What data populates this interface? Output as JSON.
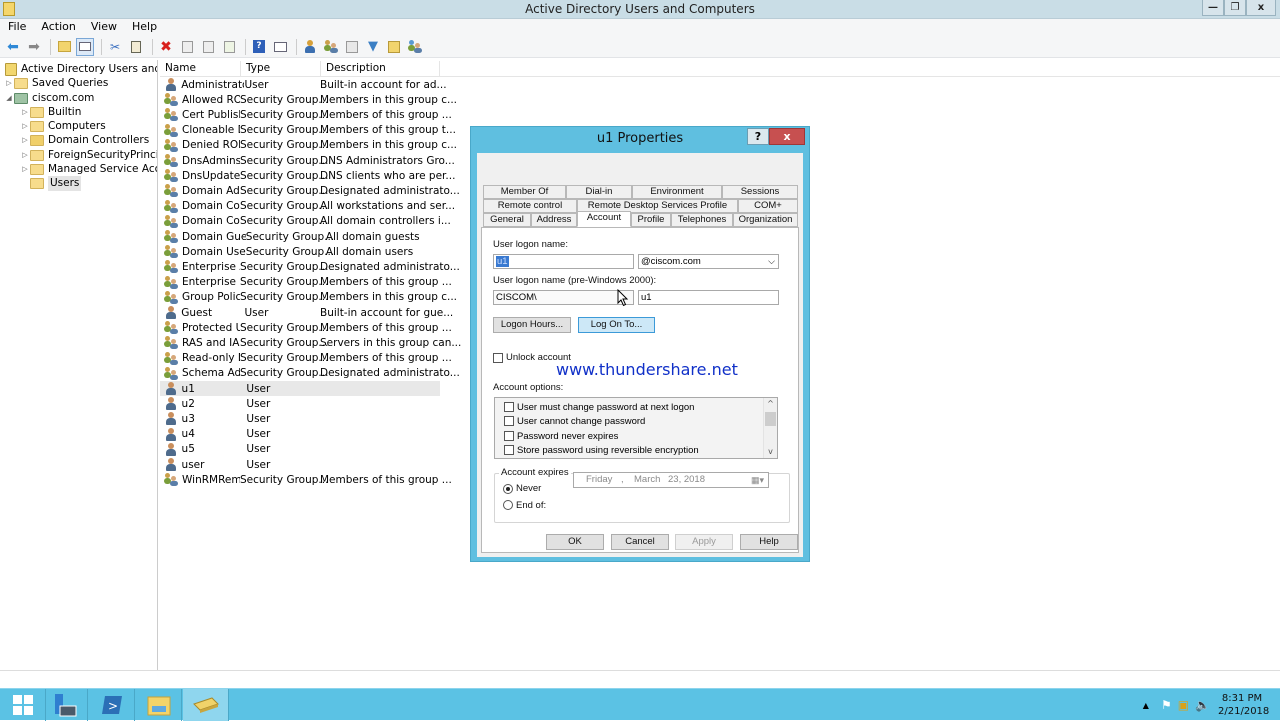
{
  "window": {
    "title": "Active Directory Users and Computers",
    "buttons": {
      "minimize": "—",
      "restore": "❐",
      "close": "x"
    }
  },
  "menu": [
    "File",
    "Action",
    "View",
    "Help"
  ],
  "toolbar": [
    "back-icon",
    "forward-icon",
    "up-folder-icon",
    "show-hide-console-tree-icon",
    "cut-icon",
    "copy-icon",
    "delete-icon",
    "properties-icon",
    "refresh-icon",
    "export-list-icon",
    "help-icon",
    "show-action-pane-icon",
    "new-user-icon",
    "new-group-icon",
    "new-ou-icon",
    "filter-icon",
    "find-icon",
    "add-to-group-icon"
  ],
  "tree": {
    "root": "Active Directory Users and Com",
    "items": [
      {
        "label": "Saved Queries",
        "level": 1,
        "expander": "▷"
      },
      {
        "label": "ciscom.com",
        "level": 1,
        "expander": "◢"
      },
      {
        "label": "Builtin",
        "level": 2,
        "expander": "▷"
      },
      {
        "label": "Computers",
        "level": 2,
        "expander": "▷"
      },
      {
        "label": "Domain Controllers",
        "level": 2,
        "expander": "▷"
      },
      {
        "label": "ForeignSecurityPrincipals",
        "level": 2,
        "expander": "▷"
      },
      {
        "label": "Managed Service Accounts",
        "level": 2,
        "expander": "▷"
      },
      {
        "label": "Users",
        "level": 2,
        "expander": ""
      }
    ]
  },
  "list": {
    "columns": [
      "Name",
      "Type",
      "Description"
    ],
    "rows": [
      {
        "name": "Administrator",
        "type": "User",
        "desc": "Built-in account for ad...",
        "kind": "user"
      },
      {
        "name": "Allowed RO...",
        "type": "Security Group...",
        "desc": "Members in this group c...",
        "kind": "group"
      },
      {
        "name": "Cert Publish...",
        "type": "Security Group...",
        "desc": "Members of this group ...",
        "kind": "group"
      },
      {
        "name": "Cloneable D...",
        "type": "Security Group...",
        "desc": "Members of this group t...",
        "kind": "group"
      },
      {
        "name": "Denied ROD...",
        "type": "Security Group...",
        "desc": "Members in this group c...",
        "kind": "group"
      },
      {
        "name": "DnsAdmins",
        "type": "Security Group...",
        "desc": "DNS Administrators Gro...",
        "kind": "group"
      },
      {
        "name": "DnsUpdateP...",
        "type": "Security Group...",
        "desc": "DNS clients who are per...",
        "kind": "group"
      },
      {
        "name": "Domain Ad...",
        "type": "Security Group...",
        "desc": "Designated administrato...",
        "kind": "group"
      },
      {
        "name": "Domain Co...",
        "type": "Security Group...",
        "desc": "All workstations and ser...",
        "kind": "group"
      },
      {
        "name": "Domain Con...",
        "type": "Security Group...",
        "desc": "All domain controllers i...",
        "kind": "group"
      },
      {
        "name": "Domain Gue...",
        "type": "Security Group...",
        "desc": "All domain guests",
        "kind": "group"
      },
      {
        "name": "Domain Users",
        "type": "Security Group...",
        "desc": "All domain users",
        "kind": "group"
      },
      {
        "name": "Enterprise A...",
        "type": "Security Group...",
        "desc": "Designated administrato...",
        "kind": "group"
      },
      {
        "name": "Enterprise R...",
        "type": "Security Group...",
        "desc": "Members of this group ...",
        "kind": "group"
      },
      {
        "name": "Group Polic...",
        "type": "Security Group...",
        "desc": "Members in this group c...",
        "kind": "group"
      },
      {
        "name": "Guest",
        "type": "User",
        "desc": "Built-in account for gue...",
        "kind": "user"
      },
      {
        "name": "Protected Us...",
        "type": "Security Group...",
        "desc": "Members of this group ...",
        "kind": "group"
      },
      {
        "name": "RAS and IAS ...",
        "type": "Security Group...",
        "desc": "Servers in this group can...",
        "kind": "group"
      },
      {
        "name": "Read-only D...",
        "type": "Security Group...",
        "desc": "Members of this group ...",
        "kind": "group"
      },
      {
        "name": "Schema Ad...",
        "type": "Security Group...",
        "desc": "Designated administrato...",
        "kind": "group"
      },
      {
        "name": "u1",
        "type": "User",
        "desc": "",
        "kind": "user",
        "selected": true
      },
      {
        "name": "u2",
        "type": "User",
        "desc": "",
        "kind": "user"
      },
      {
        "name": "u3",
        "type": "User",
        "desc": "",
        "kind": "user"
      },
      {
        "name": "u4",
        "type": "User",
        "desc": "",
        "kind": "user"
      },
      {
        "name": "u5",
        "type": "User",
        "desc": "",
        "kind": "user"
      },
      {
        "name": "user",
        "type": "User",
        "desc": "",
        "kind": "user"
      },
      {
        "name": "WinRMRem...",
        "type": "Security Group...",
        "desc": "Members of this group ...",
        "kind": "group"
      }
    ]
  },
  "dialog": {
    "title": "u1 Properties",
    "help_btn": "?",
    "close_btn": "x",
    "tabs_row1": [
      "Member Of",
      "Dial-in",
      "Environment",
      "Sessions"
    ],
    "tabs_row2": [
      "Remote control",
      "Remote Desktop Services Profile",
      "COM+"
    ],
    "tabs_row3": [
      "General",
      "Address",
      "Account",
      "Profile",
      "Telephones",
      "Organization"
    ],
    "active_tab": "Account",
    "logon_name_label": "User logon name:",
    "logon_name_value": "u1",
    "upn_suffix": "@ciscom.com",
    "pre2000_label": "User logon name (pre-Windows 2000):",
    "pre2000_domain": "CISCOM\\",
    "pre2000_user": "u1",
    "logon_hours_btn": "Logon Hours...",
    "log_on_to_btn": "Log On To...",
    "unlock_label": "Unlock account",
    "options_label": "Account options:",
    "options": [
      "User must change password at next logon",
      "User cannot change password",
      "Password never expires",
      "Store password using reversible encryption"
    ],
    "expires_label": "Account expires",
    "never_label": "Never",
    "endof_label": "End of:",
    "date": {
      "day": "Friday",
      "sep": ",",
      "month": "March",
      "rest": "23, 2018"
    },
    "ok": "OK",
    "cancel": "Cancel",
    "apply": "Apply",
    "help": "Help"
  },
  "watermark": "www.thundershare.net",
  "taskbar": {
    "apps": [
      "start-icon",
      "server-manager-icon",
      "powershell-icon",
      "file-explorer-icon",
      "ad-users-computers-icon"
    ],
    "time": "8:31 PM",
    "date": "2/21/2018"
  }
}
